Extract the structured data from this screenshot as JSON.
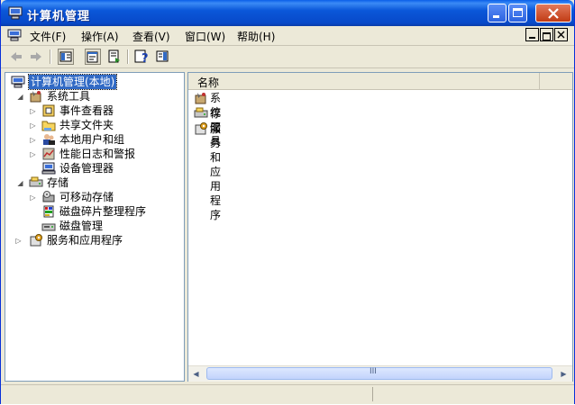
{
  "window": {
    "title": "计算机管理"
  },
  "menubar": {
    "items": [
      {
        "label": "文件(F)"
      },
      {
        "label": "操作(A)"
      },
      {
        "label": "查看(V)"
      },
      {
        "label": "窗口(W)"
      },
      {
        "label": "帮助(H)"
      }
    ]
  },
  "toolbar": {
    "buttons": [
      "back-icon",
      "forward-icon",
      "show-hide-tree-icon",
      "properties-icon",
      "export-list-icon",
      "help-icon",
      "show-hide-action-pane-icon"
    ]
  },
  "tree": {
    "root": {
      "label": "计算机管理(本地)",
      "icon": "computer-icon"
    },
    "nodes": [
      {
        "label": "系统工具",
        "icon": "system-tools-icon",
        "expanded": true
      },
      {
        "label": "事件查看器",
        "icon": "event-viewer-icon"
      },
      {
        "label": "共享文件夹",
        "icon": "shared-folder-icon"
      },
      {
        "label": "本地用户和组",
        "icon": "users-groups-icon"
      },
      {
        "label": "性能日志和警报",
        "icon": "perf-logs-icon"
      },
      {
        "label": "设备管理器",
        "icon": "device-manager-icon"
      },
      {
        "label": "存储",
        "icon": "storage-icon",
        "expanded": true
      },
      {
        "label": "可移动存储",
        "icon": "removable-storage-icon"
      },
      {
        "label": "磁盘碎片整理程序",
        "icon": "defrag-icon"
      },
      {
        "label": "磁盘管理",
        "icon": "disk-management-icon"
      },
      {
        "label": "服务和应用程序",
        "icon": "services-apps-icon"
      }
    ]
  },
  "list": {
    "column_header": "名称",
    "items": [
      {
        "label": "系统工具",
        "icon": "system-tools-icon"
      },
      {
        "label": "存储",
        "icon": "storage-icon"
      },
      {
        "label": "服务和应用程序",
        "icon": "services-apps-icon"
      }
    ]
  },
  "scrollbar": {
    "grip": "III"
  },
  "colors": {
    "title_blue": "#0a57d9",
    "selection": "#316ac5",
    "chrome": "#ece9d8",
    "close_red": "#c13b14"
  }
}
